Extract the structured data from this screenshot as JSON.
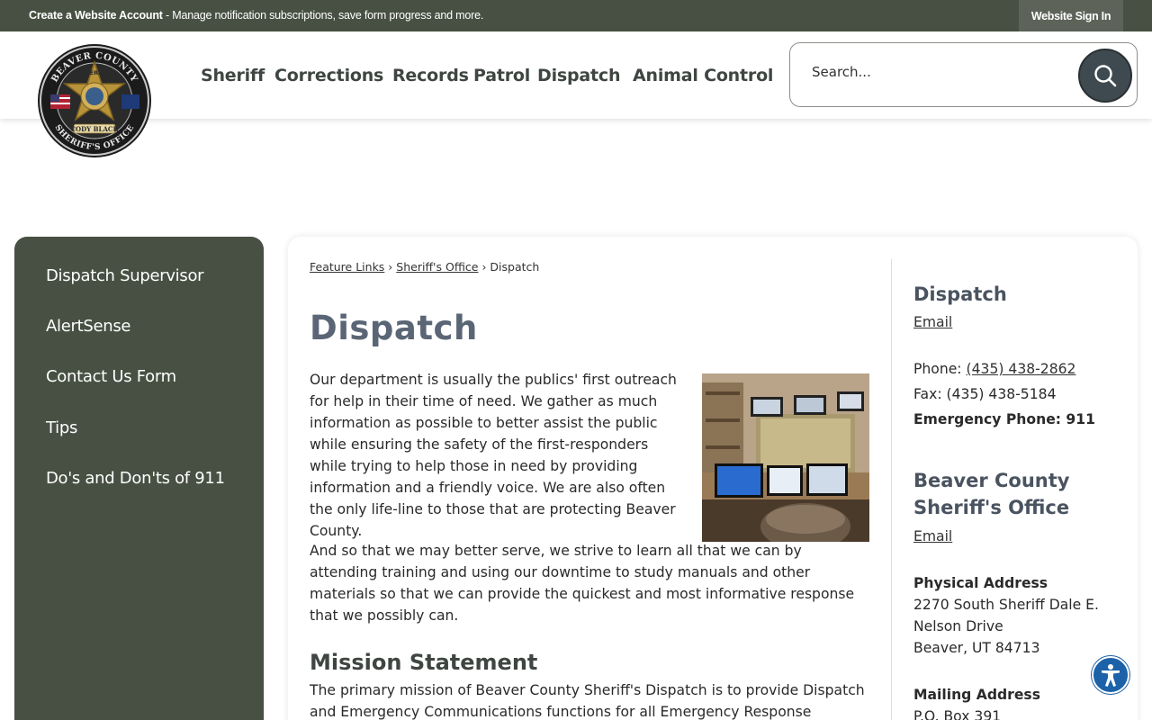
{
  "topbar": {
    "account_bold": "Create a Website Account",
    "account_rest": " - Manage notification subscriptions, save form progress and more.",
    "signin": "Website Sign In"
  },
  "nav": {
    "items": [
      "Sheriff",
      "Corrections",
      "Records",
      "Patrol",
      "Dispatch",
      "Animal Control"
    ]
  },
  "search": {
    "placeholder": "Search..."
  },
  "sidebar": {
    "items": [
      "Dispatch Supervisor",
      "AlertSense",
      "Contact Us Form",
      "Tips",
      "Do's and Don'ts of 911"
    ]
  },
  "breadcrumb": {
    "link1": "Feature Links",
    "sep": " › ",
    "link2": "Sheriff's Office",
    "current": "Dispatch"
  },
  "main": {
    "title": "Dispatch",
    "para1": "Our department is usually the publics' first outreach for help in their time of need. We gather as much information as possible to better assist the public while ensuring the safety of the first-responders while trying to help those in need by providing information and a friendly voice. We are also often the only life-line to those that are protecting Beaver County.",
    "para2": "And so that we may better serve, we strive to learn all that we can by attending training and using our downtime to study manuals and other materials so that we can provide the quickest and most informative response that we possibly can.",
    "mission_heading": "Mission Statement",
    "mission_text": "The primary mission of Beaver County Sheriff's Dispatch is to provide Dispatch and Emergency Communications functions for all Emergency Response Agencies in the"
  },
  "contact": {
    "dispatch_heading": "Dispatch",
    "email_label": "Email",
    "phone_label": "Phone: ",
    "phone": "(435) 438-2862",
    "fax": "Fax: (435) 438-5184",
    "emergency": "Emergency Phone: 911",
    "office_heading_1": "Beaver County",
    "office_heading_2": "Sheriff's Office",
    "office_email_label": "Email",
    "physical_label": "Physical Address",
    "physical_1": "2270 South Sheriff Dale E.",
    "physical_2": "Nelson Drive",
    "physical_3": "Beaver, UT 84713",
    "mailing_label": "Mailing Address",
    "mailing_1": "P.O. Box 391"
  },
  "logo": {
    "top_text": "BEAVER COUNTY",
    "star_text": "SHERIFF",
    "bottom_text": "SHERIFF'S OFFICE",
    "banner_text": "CODY BLACK"
  }
}
